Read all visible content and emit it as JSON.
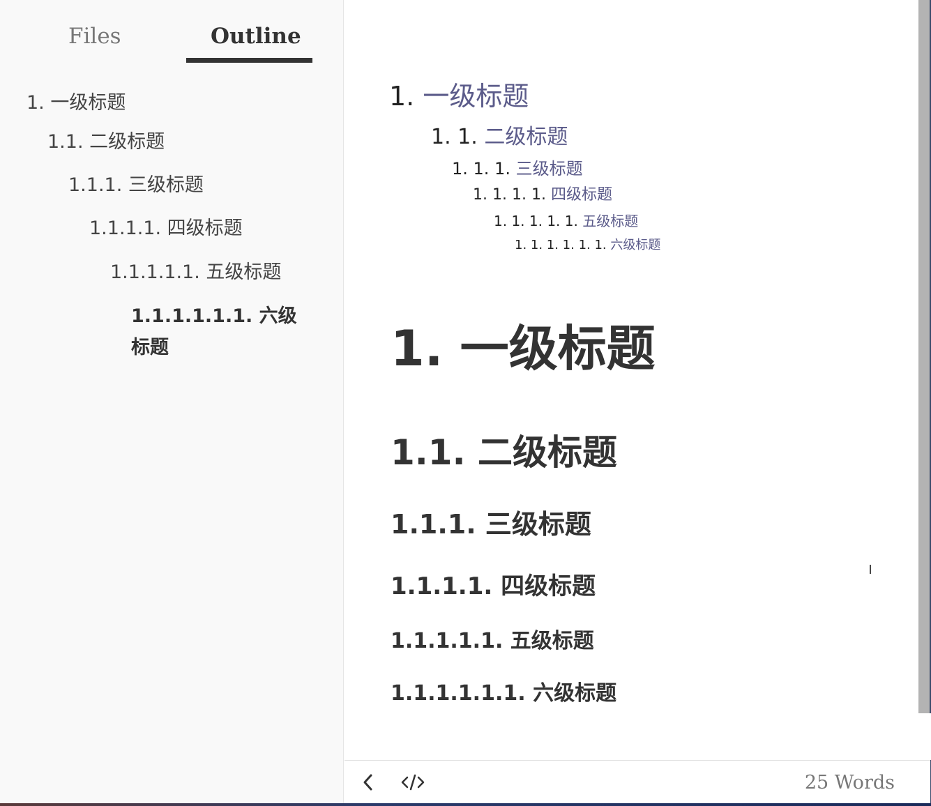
{
  "sidebar": {
    "tabs": [
      {
        "label": "Files"
      },
      {
        "label": "Outline"
      }
    ],
    "outline": [
      {
        "label": "1. 一级标题"
      },
      {
        "label": "1.1. 二级标题"
      },
      {
        "label": "1.1.1. 三级标题"
      },
      {
        "label": "1.1.1.1. 四级标题"
      },
      {
        "label": "1.1.1.1.1. 五级标题"
      },
      {
        "label": "1.1.1.1.1.1. 六级标题"
      }
    ]
  },
  "editor": {
    "toc": [
      {
        "num": "1.",
        "text": "一级标题"
      },
      {
        "num": "1. 1.",
        "text": "二级标题"
      },
      {
        "num": "1. 1. 1.",
        "text": "三级标题"
      },
      {
        "num": "1. 1. 1. 1.",
        "text": "四级标题"
      },
      {
        "num": "1. 1. 1. 1. 1.",
        "text": "五级标题"
      },
      {
        "num": "1. 1. 1. 1. 1. 1.",
        "text": "六级标题"
      }
    ],
    "headings": [
      {
        "text": "1. 一级标题"
      },
      {
        "text": "1.1. 二级标题"
      },
      {
        "text": "1.1.1. 三级标题"
      },
      {
        "text": "1.1.1.1. 四级标题"
      },
      {
        "text": "1.1.1.1.1. 五级标题"
      },
      {
        "text": "1.1.1.1.1.1. 六级标题"
      }
    ],
    "cursor_glyph": "I"
  },
  "footer": {
    "back_icon": "chevron-left-icon",
    "source_icon": "code-icon",
    "word_count": "25 Words"
  },
  "colors": {
    "sidebar_bg": "#f9f9f9",
    "text": "#333333",
    "muted": "#777777",
    "toc_link": "#5b5b8a",
    "scrollbar_thumb": "#b3b3b3"
  }
}
